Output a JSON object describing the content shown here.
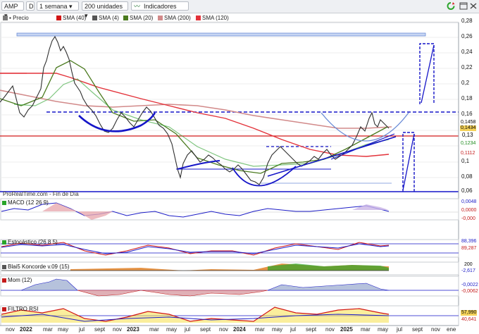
{
  "toolbar": {
    "ticker": "AMP",
    "d_label": "D",
    "period": "1 semana",
    "units": "200 unidades",
    "indicators_label": "Indicadores"
  },
  "legend": [
    {
      "label": "Precio",
      "color": "#7a7a7a"
    },
    {
      "label": "SMA (40)",
      "color": "#d11515"
    },
    {
      "label": "SMA (4)",
      "color": "#555555"
    },
    {
      "label": "SMA (20)",
      "color": "#4a7a1e"
    },
    {
      "label": "SMA (200)",
      "color": "#d28a8a"
    },
    {
      "label": "SMA (120)",
      "color": "#e3323a"
    }
  ],
  "price_axis": [
    "0,28",
    "0,26",
    "0,24",
    "0,22",
    "0,2",
    "0,18",
    "0,16",
    "0,14",
    "0,12",
    "0,1",
    "0,08",
    "0,06"
  ],
  "price_tags": [
    {
      "text": "0,1458",
      "color": "#000000",
      "bg": "#ffffff"
    },
    {
      "text": "0,1434",
      "color": "#000000",
      "bg": "#f4d25a"
    },
    {
      "text": "0,13",
      "color": "#000000",
      "bg": "#ffffff"
    },
    {
      "text": "0,1234",
      "color": "#1c8a1c",
      "bg": "#ffffff"
    },
    {
      "text": "0,1112",
      "color": "#c41a1a",
      "bg": "#ffffff"
    }
  ],
  "source_text": "ProRealTime.com - Fin de Día",
  "panels": {
    "macd": {
      "title": "MACD (12 26 9)",
      "values": [
        "0,0048",
        "0,0000",
        "-0,000"
      ]
    },
    "stoch": {
      "title": "Estocástico (26 8 5)",
      "values": [
        "88,396",
        "89,287"
      ]
    },
    "koncorde": {
      "title": "Blai5 Koncorde v.09 (15)",
      "values": [
        "200",
        "-2,617"
      ]
    },
    "mom": {
      "title": "Mom (12)",
      "values": [
        "-0,0022",
        "-0,0062"
      ]
    },
    "rsi": {
      "title": "FILTRO RSI",
      "values": [
        "57,990",
        "40,641"
      ]
    }
  },
  "x_axis": [
    "nov",
    "2022",
    "mar",
    "may",
    "jul",
    "sept",
    "nov",
    "2023",
    "mar",
    "may",
    "jul",
    "sept",
    "nov",
    "2024",
    "mar",
    "may",
    "jul",
    "sept",
    "nov",
    "2025",
    "mar",
    "may",
    "jul",
    "sept",
    "nov",
    "ene"
  ],
  "chart_data": {
    "type": "line",
    "title": "AMP",
    "x": [
      "nov 2021",
      "2022",
      "mar 2022",
      "may 2022",
      "jul 2022",
      "sept 2022",
      "nov 2022",
      "2023",
      "mar 2023",
      "may 2023",
      "jul 2023",
      "sept 2023",
      "nov 2023",
      "2024",
      "mar 2024",
      "may 2024",
      "jul 2024",
      "sept 2024",
      "nov 2024",
      "2025",
      "mar 2025",
      "may 2025"
    ],
    "series": [
      {
        "name": "Precio",
        "values": [
          0.178,
          0.168,
          0.205,
          0.262,
          0.215,
          0.155,
          0.158,
          0.162,
          0.148,
          0.132,
          0.092,
          0.098,
          0.093,
          0.082,
          0.071,
          0.106,
          0.095,
          0.102,
          0.108,
          0.128,
          0.152,
          0.1434
        ]
      },
      {
        "name": "SMA (40)",
        "values": [
          0.185,
          0.178,
          0.175,
          0.182,
          0.188,
          0.18,
          0.168,
          0.158,
          0.15,
          0.142,
          0.13,
          0.118,
          0.108,
          0.098,
          0.09,
          0.092,
          0.096,
          0.1,
          0.105,
          0.112,
          0.122,
          0.1112
        ]
      }
    ],
    "ylim": [
      0.06,
      0.28
    ]
  }
}
